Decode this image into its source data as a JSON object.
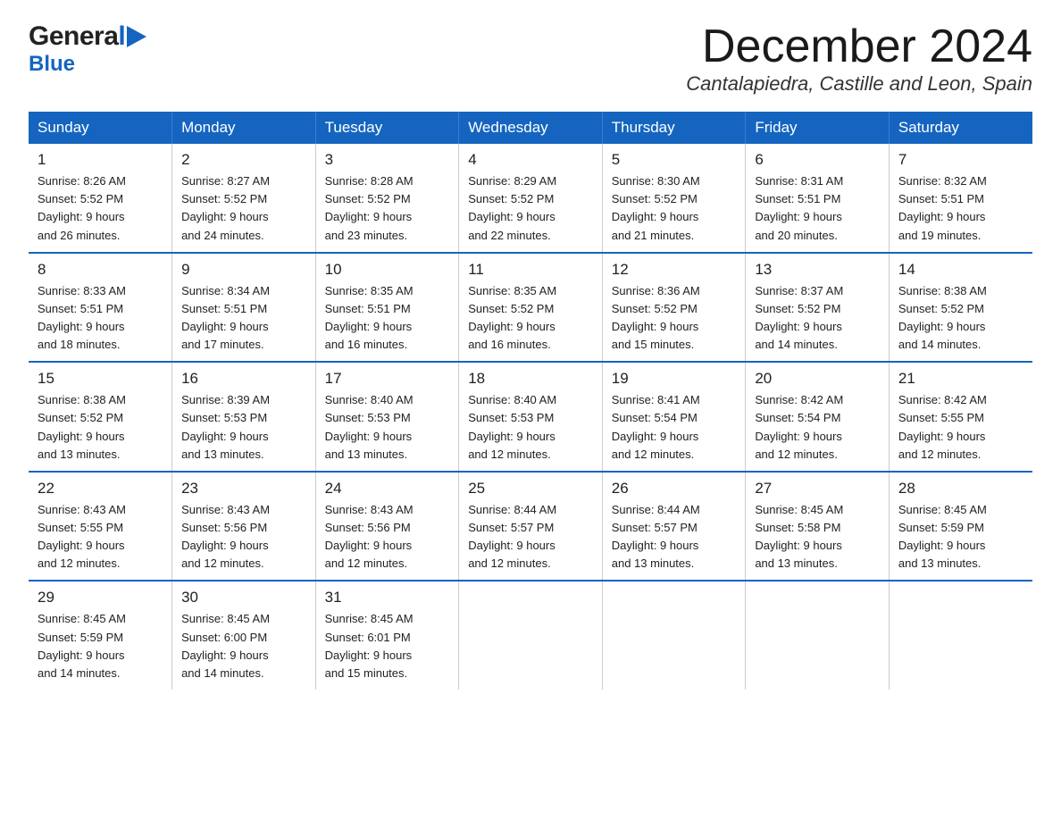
{
  "header": {
    "month_title": "December 2024",
    "location": "Cantalapiedra, Castille and Leon, Spain",
    "logo_general": "General",
    "logo_blue": "Blue"
  },
  "days_of_week": [
    "Sunday",
    "Monday",
    "Tuesday",
    "Wednesday",
    "Thursday",
    "Friday",
    "Saturday"
  ],
  "weeks": [
    [
      {
        "day": "1",
        "sunrise": "8:26 AM",
        "sunset": "5:52 PM",
        "daylight": "9 hours and 26 minutes."
      },
      {
        "day": "2",
        "sunrise": "8:27 AM",
        "sunset": "5:52 PM",
        "daylight": "9 hours and 24 minutes."
      },
      {
        "day": "3",
        "sunrise": "8:28 AM",
        "sunset": "5:52 PM",
        "daylight": "9 hours and 23 minutes."
      },
      {
        "day": "4",
        "sunrise": "8:29 AM",
        "sunset": "5:52 PM",
        "daylight": "9 hours and 22 minutes."
      },
      {
        "day": "5",
        "sunrise": "8:30 AM",
        "sunset": "5:52 PM",
        "daylight": "9 hours and 21 minutes."
      },
      {
        "day": "6",
        "sunrise": "8:31 AM",
        "sunset": "5:51 PM",
        "daylight": "9 hours and 20 minutes."
      },
      {
        "day": "7",
        "sunrise": "8:32 AM",
        "sunset": "5:51 PM",
        "daylight": "9 hours and 19 minutes."
      }
    ],
    [
      {
        "day": "8",
        "sunrise": "8:33 AM",
        "sunset": "5:51 PM",
        "daylight": "9 hours and 18 minutes."
      },
      {
        "day": "9",
        "sunrise": "8:34 AM",
        "sunset": "5:51 PM",
        "daylight": "9 hours and 17 minutes."
      },
      {
        "day": "10",
        "sunrise": "8:35 AM",
        "sunset": "5:51 PM",
        "daylight": "9 hours and 16 minutes."
      },
      {
        "day": "11",
        "sunrise": "8:35 AM",
        "sunset": "5:52 PM",
        "daylight": "9 hours and 16 minutes."
      },
      {
        "day": "12",
        "sunrise": "8:36 AM",
        "sunset": "5:52 PM",
        "daylight": "9 hours and 15 minutes."
      },
      {
        "day": "13",
        "sunrise": "8:37 AM",
        "sunset": "5:52 PM",
        "daylight": "9 hours and 14 minutes."
      },
      {
        "day": "14",
        "sunrise": "8:38 AM",
        "sunset": "5:52 PM",
        "daylight": "9 hours and 14 minutes."
      }
    ],
    [
      {
        "day": "15",
        "sunrise": "8:38 AM",
        "sunset": "5:52 PM",
        "daylight": "9 hours and 13 minutes."
      },
      {
        "day": "16",
        "sunrise": "8:39 AM",
        "sunset": "5:53 PM",
        "daylight": "9 hours and 13 minutes."
      },
      {
        "day": "17",
        "sunrise": "8:40 AM",
        "sunset": "5:53 PM",
        "daylight": "9 hours and 13 minutes."
      },
      {
        "day": "18",
        "sunrise": "8:40 AM",
        "sunset": "5:53 PM",
        "daylight": "9 hours and 12 minutes."
      },
      {
        "day": "19",
        "sunrise": "8:41 AM",
        "sunset": "5:54 PM",
        "daylight": "9 hours and 12 minutes."
      },
      {
        "day": "20",
        "sunrise": "8:42 AM",
        "sunset": "5:54 PM",
        "daylight": "9 hours and 12 minutes."
      },
      {
        "day": "21",
        "sunrise": "8:42 AM",
        "sunset": "5:55 PM",
        "daylight": "9 hours and 12 minutes."
      }
    ],
    [
      {
        "day": "22",
        "sunrise": "8:43 AM",
        "sunset": "5:55 PM",
        "daylight": "9 hours and 12 minutes."
      },
      {
        "day": "23",
        "sunrise": "8:43 AM",
        "sunset": "5:56 PM",
        "daylight": "9 hours and 12 minutes."
      },
      {
        "day": "24",
        "sunrise": "8:43 AM",
        "sunset": "5:56 PM",
        "daylight": "9 hours and 12 minutes."
      },
      {
        "day": "25",
        "sunrise": "8:44 AM",
        "sunset": "5:57 PM",
        "daylight": "9 hours and 12 minutes."
      },
      {
        "day": "26",
        "sunrise": "8:44 AM",
        "sunset": "5:57 PM",
        "daylight": "9 hours and 13 minutes."
      },
      {
        "day": "27",
        "sunrise": "8:45 AM",
        "sunset": "5:58 PM",
        "daylight": "9 hours and 13 minutes."
      },
      {
        "day": "28",
        "sunrise": "8:45 AM",
        "sunset": "5:59 PM",
        "daylight": "9 hours and 13 minutes."
      }
    ],
    [
      {
        "day": "29",
        "sunrise": "8:45 AM",
        "sunset": "5:59 PM",
        "daylight": "9 hours and 14 minutes."
      },
      {
        "day": "30",
        "sunrise": "8:45 AM",
        "sunset": "6:00 PM",
        "daylight": "9 hours and 14 minutes."
      },
      {
        "day": "31",
        "sunrise": "8:45 AM",
        "sunset": "6:01 PM",
        "daylight": "9 hours and 15 minutes."
      },
      null,
      null,
      null,
      null
    ]
  ],
  "labels": {
    "sunrise": "Sunrise:",
    "sunset": "Sunset:",
    "daylight": "Daylight:"
  }
}
